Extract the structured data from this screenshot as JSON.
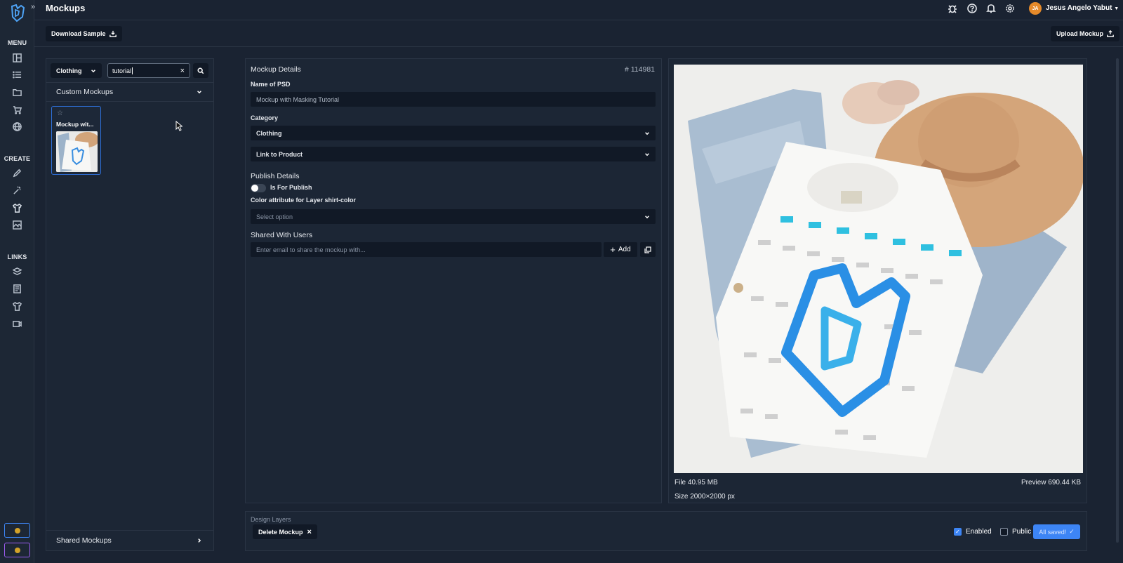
{
  "app": {
    "title": "Mockups"
  },
  "rail": {
    "menu_label": "MENU",
    "create_label": "CREATE",
    "links_label": "LINKS"
  },
  "topbar": {
    "avatar_initials": "JA",
    "user_name": "Jesus Angelo Yabut"
  },
  "toolbar": {
    "download_sample": "Download Sample",
    "upload_mockup": "Upload Mockup"
  },
  "filter": {
    "category": "Clothing",
    "search_value": "tutorial",
    "clear": "×"
  },
  "groups": {
    "custom": "Custom Mockups",
    "shared": "Shared Mockups"
  },
  "thumbnail": {
    "star": "☆",
    "name": "Mockup wit..."
  },
  "details": {
    "heading": "Mockup Details",
    "id": "# 114981",
    "name_label": "Name of PSD",
    "name_value": "Mockup with Masking Tutorial",
    "category_label": "Category",
    "category_value": "Clothing",
    "link_product": "Link to Product",
    "publish_heading": "Publish Details",
    "is_for_publish": "Is For Publish",
    "color_attr_label": "Color attribute for Layer shirt-color",
    "color_attr_value": "Select option",
    "shared_heading": "Shared With Users",
    "email_placeholder": "Enter email to share the mockup with...",
    "add_label": "Add"
  },
  "preview": {
    "file": "File 40.95 MB",
    "preview_size": "Preview 690.44 KB",
    "size": "Size 2000×2000 px"
  },
  "bottom": {
    "design_layers": "Design Layers",
    "delete_mockup": "Delete Mockup",
    "delete_x": "×",
    "enabled": "Enabled",
    "public": "Public",
    "saved": "All saved!",
    "saved_check": "✓"
  },
  "colors": {
    "accent": "#3d85f5",
    "avatar": "#e58a2a",
    "background": "#1a2332"
  }
}
